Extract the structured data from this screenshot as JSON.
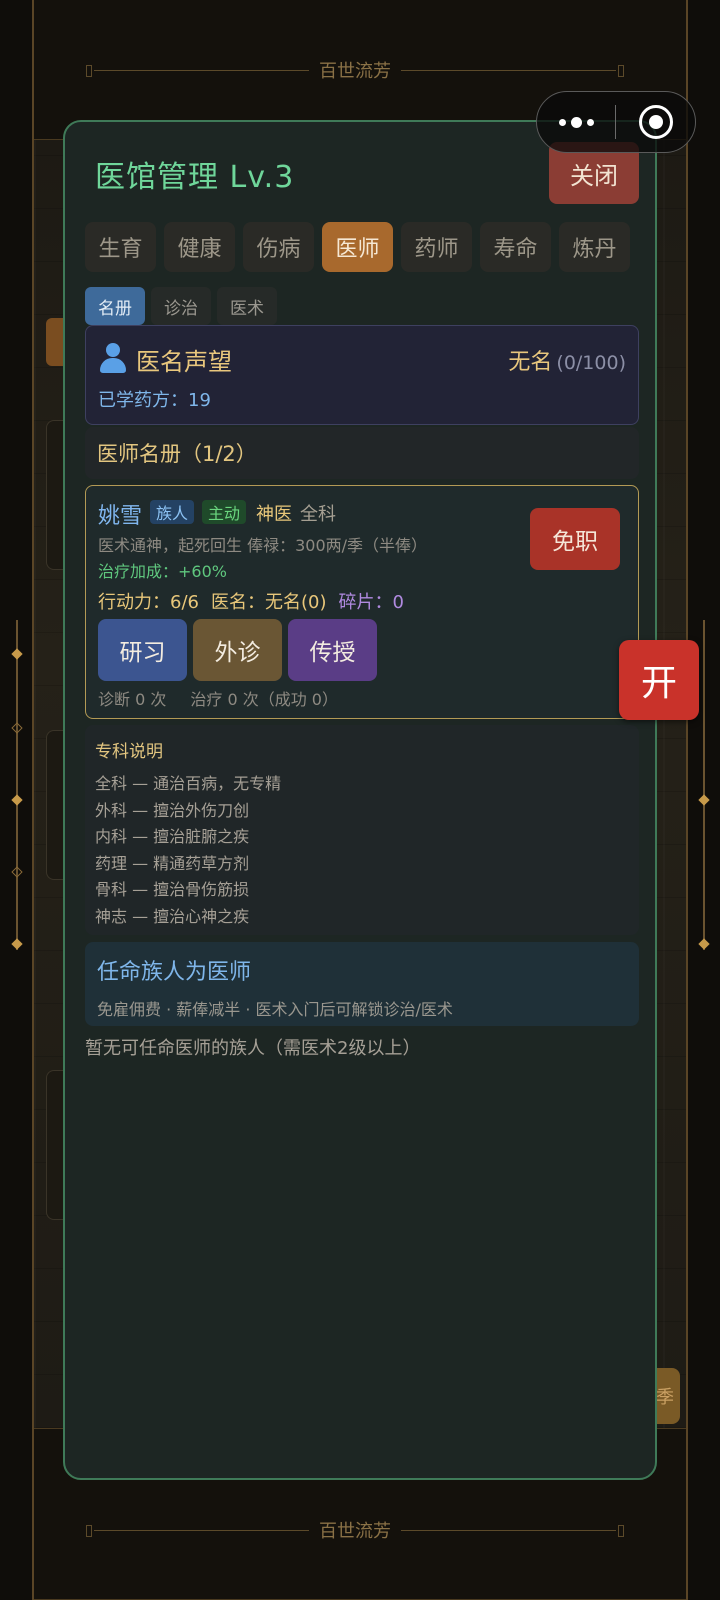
{
  "background": {
    "banner_top": "百世流芳",
    "banner_bottom": "百世流芳",
    "right_chip_label": "季"
  },
  "modal": {
    "title": "医馆管理 Lv.3",
    "close_label": "关闭",
    "tabs": [
      {
        "label": "生育",
        "active": false
      },
      {
        "label": "健康",
        "active": false
      },
      {
        "label": "伤病",
        "active": false
      },
      {
        "label": "医师",
        "active": true
      },
      {
        "label": "药师",
        "active": false
      },
      {
        "label": "寿命",
        "active": false
      },
      {
        "label": "炼丹",
        "active": false
      }
    ],
    "subtabs": [
      {
        "label": "名册",
        "active": true
      },
      {
        "label": "诊治",
        "active": false
      },
      {
        "label": "医术",
        "active": false
      }
    ],
    "fame": {
      "label": "医名声望",
      "rank": "无名",
      "progress": "(0/100)",
      "learned": "已学药方：19",
      "icon": "person-icon"
    },
    "roster_header": "医师名册（1/2）",
    "doctor": {
      "name": "姚雪",
      "badge_clan": "族人",
      "badge_active": "主动",
      "title": "神医",
      "specialty": "全科",
      "description": "医术通神，起死回生  俸禄：300两/季（半俸）",
      "bonus": "治疗加成：+60%",
      "action_points": "行动力：6/6",
      "reputation": "医名：无名(0)",
      "fragments": "碎片：0",
      "dismiss_label": "免职",
      "actions": [
        "研习",
        "外诊",
        "传授"
      ],
      "diagnose_count": "诊断 0 次",
      "treat_count": "治疗 0 次（成功 0）"
    },
    "specialty_info": {
      "title": "专科说明",
      "items": [
        "全科 — 通治百病，无专精",
        "外科 — 擅治外伤刀创",
        "内科 — 擅治脏腑之疾",
        "药理 — 精通药草方剂",
        "骨科 — 擅治骨伤筋损",
        "神志 — 擅治心神之疾"
      ]
    },
    "appoint": {
      "title": "任命族人为医师",
      "description": "免雇佣费 · 薪俸减半 · 医术入门后可解锁诊治/医术"
    },
    "none_available": "暂无可任命医师的族人（需医术2级以上）"
  },
  "floating_button": "开",
  "colors": {
    "accent_green": "#6fd69a",
    "active_tab": "#a8692d",
    "dismiss_red": "#a93328",
    "float_red": "#c9322a"
  }
}
